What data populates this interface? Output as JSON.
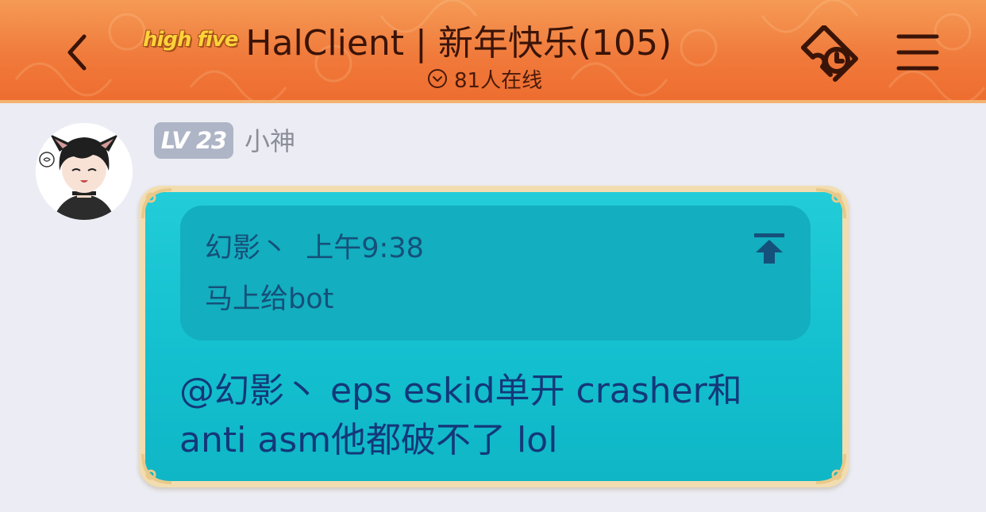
{
  "header": {
    "logo_text": "high five",
    "title": "HalClient | 新年快乐(105)",
    "online_count": "81人在线",
    "icons": {
      "back": "chevron-left-icon",
      "online": "chevron-down-circle-icon",
      "ticket": "ticket-icon",
      "menu": "hamburger-menu-icon"
    },
    "colors": {
      "bar_top": "#f59a55",
      "bar_bottom": "#ee6c2f",
      "text": "#3b1408"
    }
  },
  "message": {
    "avatar": "avatar-catgirl",
    "level": "LV 23",
    "sender": "小神",
    "quote": {
      "author": "幻影丶",
      "time": "上午9:38",
      "text": "马上给bot",
      "icon": "jump-to-top-icon"
    },
    "text_line1": "@幻影丶 eps eskid单开 crasher和",
    "text_line2": "anti asm他都破不了 lol",
    "colors": {
      "bubble": "#16c2d0",
      "bubble_border": "#f2ddb0",
      "quote_bg": "#13aebf",
      "text": "#14387a",
      "quote_text": "#15507a"
    }
  }
}
